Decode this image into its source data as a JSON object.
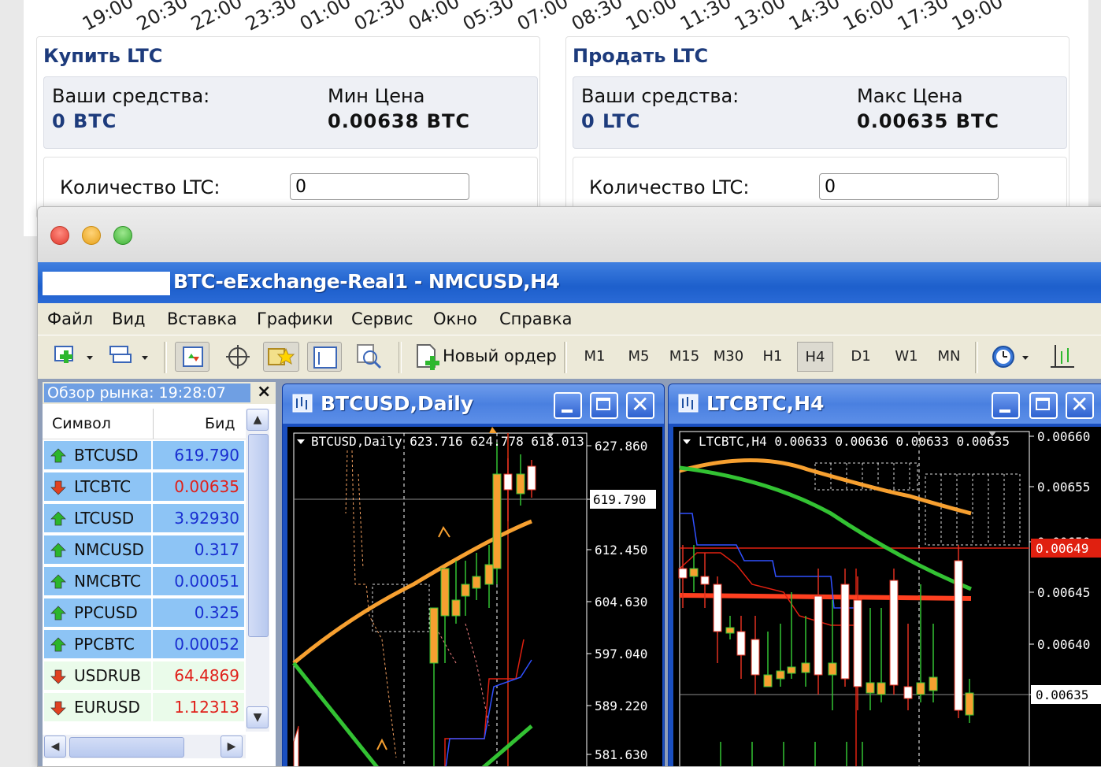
{
  "webpage": {
    "time_labels": [
      "19:00",
      "20:30",
      "22:00",
      "23:30",
      "01:00",
      "02:30",
      "04:00",
      "05:30",
      "07:00",
      "08:30",
      "10:00",
      "11:30",
      "13:00",
      "14:30",
      "16:00",
      "17:30",
      "19:00"
    ],
    "buy": {
      "title": "Купить LTC",
      "funds_label": "Ваши средства:",
      "funds_value": "0 BTC",
      "price_label": "Мин Цена",
      "price_value": "0.00638 BTC",
      "qty_label": "Количество LTC:",
      "qty_value": "0"
    },
    "sell": {
      "title": "Продать LTC",
      "funds_label": "Ваши средства:",
      "funds_value": "0 LTC",
      "price_label": "Макс Цена",
      "price_value": "0.00635 BTC",
      "qty_label": "Количество LTC:",
      "qty_value": "0"
    }
  },
  "app": {
    "title": "BTC-eExchange-Real1 - NMCUSD,H4",
    "menu": [
      "Файл",
      "Вид",
      "Вставка",
      "Графики",
      "Сервис",
      "Окно",
      "Справка"
    ],
    "new_order_label": "Новый ордер",
    "timeframes": [
      "M1",
      "M5",
      "M15",
      "M30",
      "H1",
      "H4",
      "D1",
      "W1",
      "MN"
    ],
    "active_timeframe": "H4"
  },
  "market_watch": {
    "title": "Обзор рынка: 19:28:07",
    "col_symbol": "Символ",
    "col_bid": "Бид",
    "rows": [
      {
        "symbol": "BTCUSD",
        "bid": "619.790",
        "dir": "up",
        "selected": true
      },
      {
        "symbol": "LTCBTC",
        "bid": "0.00635",
        "dir": "down",
        "selected": true
      },
      {
        "symbol": "LTCUSD",
        "bid": "3.92930",
        "dir": "up",
        "selected": true
      },
      {
        "symbol": "NMCUSD",
        "bid": "0.317",
        "dir": "up",
        "selected": true
      },
      {
        "symbol": "NMCBTC",
        "bid": "0.00051",
        "dir": "up",
        "selected": true
      },
      {
        "symbol": "PPCUSD",
        "bid": "0.325",
        "dir": "up",
        "selected": true
      },
      {
        "symbol": "PPCBTC",
        "bid": "0.00052",
        "dir": "up",
        "selected": true
      },
      {
        "symbol": "USDRUB",
        "bid": "64.4869",
        "dir": "down",
        "selected": false
      },
      {
        "symbol": "EURUSD",
        "bid": "1.12313",
        "dir": "down",
        "selected": false
      }
    ],
    "colors": {
      "selected": "#8dc4f5",
      "unselected": "#eafbea",
      "up": "#2bb52b",
      "down": "#e04020",
      "bid_selected": "#1a2fd0",
      "bid_down": "#e0201a"
    }
  },
  "charts": [
    {
      "title": "BTCUSD,Daily",
      "info": "BTCUSD,Daily  623.716 624.778 618.013",
      "price_labels": [
        "627.860",
        "619.790",
        "612.450",
        "604.630",
        "597.040",
        "589.220",
        "581.630"
      ],
      "current_price": "619.790"
    },
    {
      "title": "LTCBTC,H4",
      "info": "LTCBTC,H4  0.00633 0.00636 0.00633 0.00635",
      "price_labels": [
        "0.00660",
        "0.00655",
        "0.00650",
        "0.00645",
        "0.00640",
        "0.00635"
      ],
      "red_label": "0.00649",
      "current_price": "0.00635"
    }
  ]
}
